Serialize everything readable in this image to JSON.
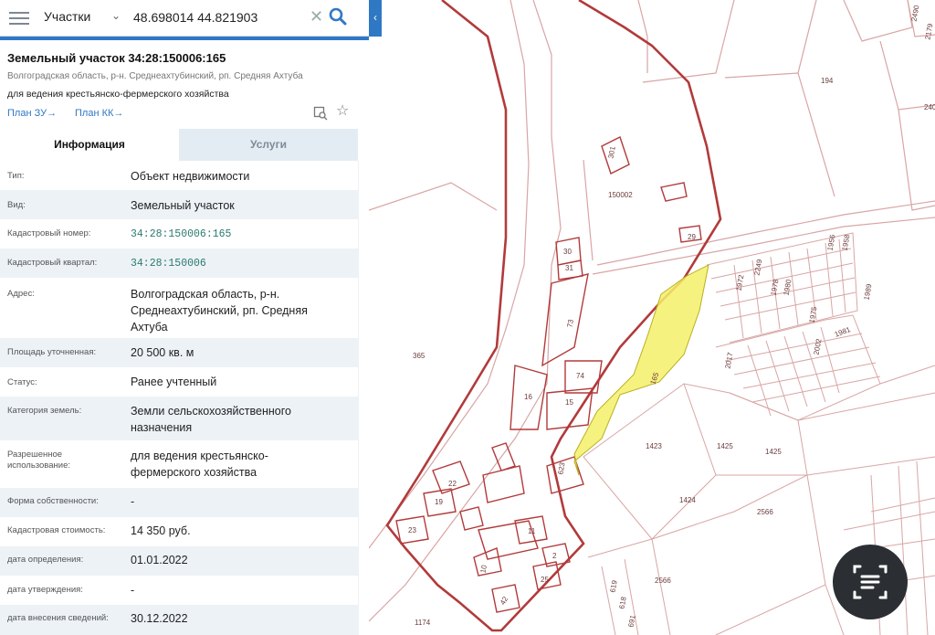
{
  "search": {
    "layer": "Участки",
    "query": "48.698014 44.821903"
  },
  "header": {
    "title": "Земельный участок 34:28:150006:165",
    "address": "Волгоградская область, р-н. Среднеахтубинский, рп. Средняя Ахтуба",
    "use": "для ведения крестьянско-фермерского хозяйства",
    "link_plan_zu": "План ЗУ→",
    "link_plan_kk": "План КК→"
  },
  "tabs": {
    "info": "Информация",
    "services": "Услуги"
  },
  "properties": [
    {
      "key": "Тип:",
      "value": "Объект недвижимости"
    },
    {
      "key": "Вид:",
      "value": "Земельный участок"
    },
    {
      "key": "Кадастровый номер:",
      "value": "34:28:150006:165"
    },
    {
      "key": "Кадастровый квартал:",
      "value": "34:28:150006"
    },
    {
      "key": "Адрес:",
      "value": "Волгоградская область, р-н. Среднеахтубинский, рп. Средняя Ахтуба"
    },
    {
      "key": "Площадь уточненная:",
      "value": "20 500 кв. м"
    },
    {
      "key": "Статус:",
      "value": "Ранее учтенный"
    },
    {
      "key": "Категория земель:",
      "value": "Земли сельскохозяйственного назначения"
    },
    {
      "key": "Разрешенное использование:",
      "value": "для ведения крестьянско-фермерского хозяйства"
    },
    {
      "key": "Форма собственности:",
      "value": "-"
    },
    {
      "key": "Кадастровая стоимость:",
      "value": "14 350 руб."
    },
    {
      "key": "дата определения:",
      "value": "01.01.2022"
    },
    {
      "key": "дата утверждения:",
      "value": "-"
    },
    {
      "key": "дата внесения сведений:",
      "value": "30.12.2022"
    }
  ],
  "map": {
    "labels": {
      "p194": "194",
      "p301": "301",
      "p150002": "150002",
      "p29": "29",
      "p30": "30",
      "p31": "31",
      "p73": "73",
      "p365": "365",
      "p74": "74",
      "p16": "16",
      "p15": "15",
      "p165": "165",
      "p623": "623",
      "p1423": "1423",
      "p1425a": "1425",
      "p1425b": "1425",
      "p1424": "1424",
      "p2566a": "2566",
      "p2566b": "2566",
      "p22": "22",
      "p19": "19",
      "p23": "23",
      "p11": "11",
      "p2": "2",
      "p10": "10",
      "p25": "25",
      "p42": "42",
      "p1174": "1174",
      "p619": "619",
      "p618": "618",
      "p691": "691",
      "p1972": "1972",
      "p2249": "2249",
      "p1978": "1978",
      "p1980": "1980",
      "p1956": "1956",
      "p1958": "1958",
      "p1975": "1975",
      "p1981": "1981",
      "p1989": "1989",
      "p2017": "2017",
      "p2002": "2002",
      "p2490": "2490",
      "p2179": "2179",
      "p240": "240"
    },
    "colors": {
      "highlight": "#f5f06a",
      "boundary": "#b23a3a",
      "lines": "#d9a5a5"
    }
  },
  "icons": {
    "menu": "hamburger-menu-icon",
    "search": "search-icon",
    "clear": "close-icon",
    "collapse": "chevron-left-icon",
    "copy": "copy-icon",
    "star": "star-icon",
    "lens": "text-scan-icon"
  }
}
